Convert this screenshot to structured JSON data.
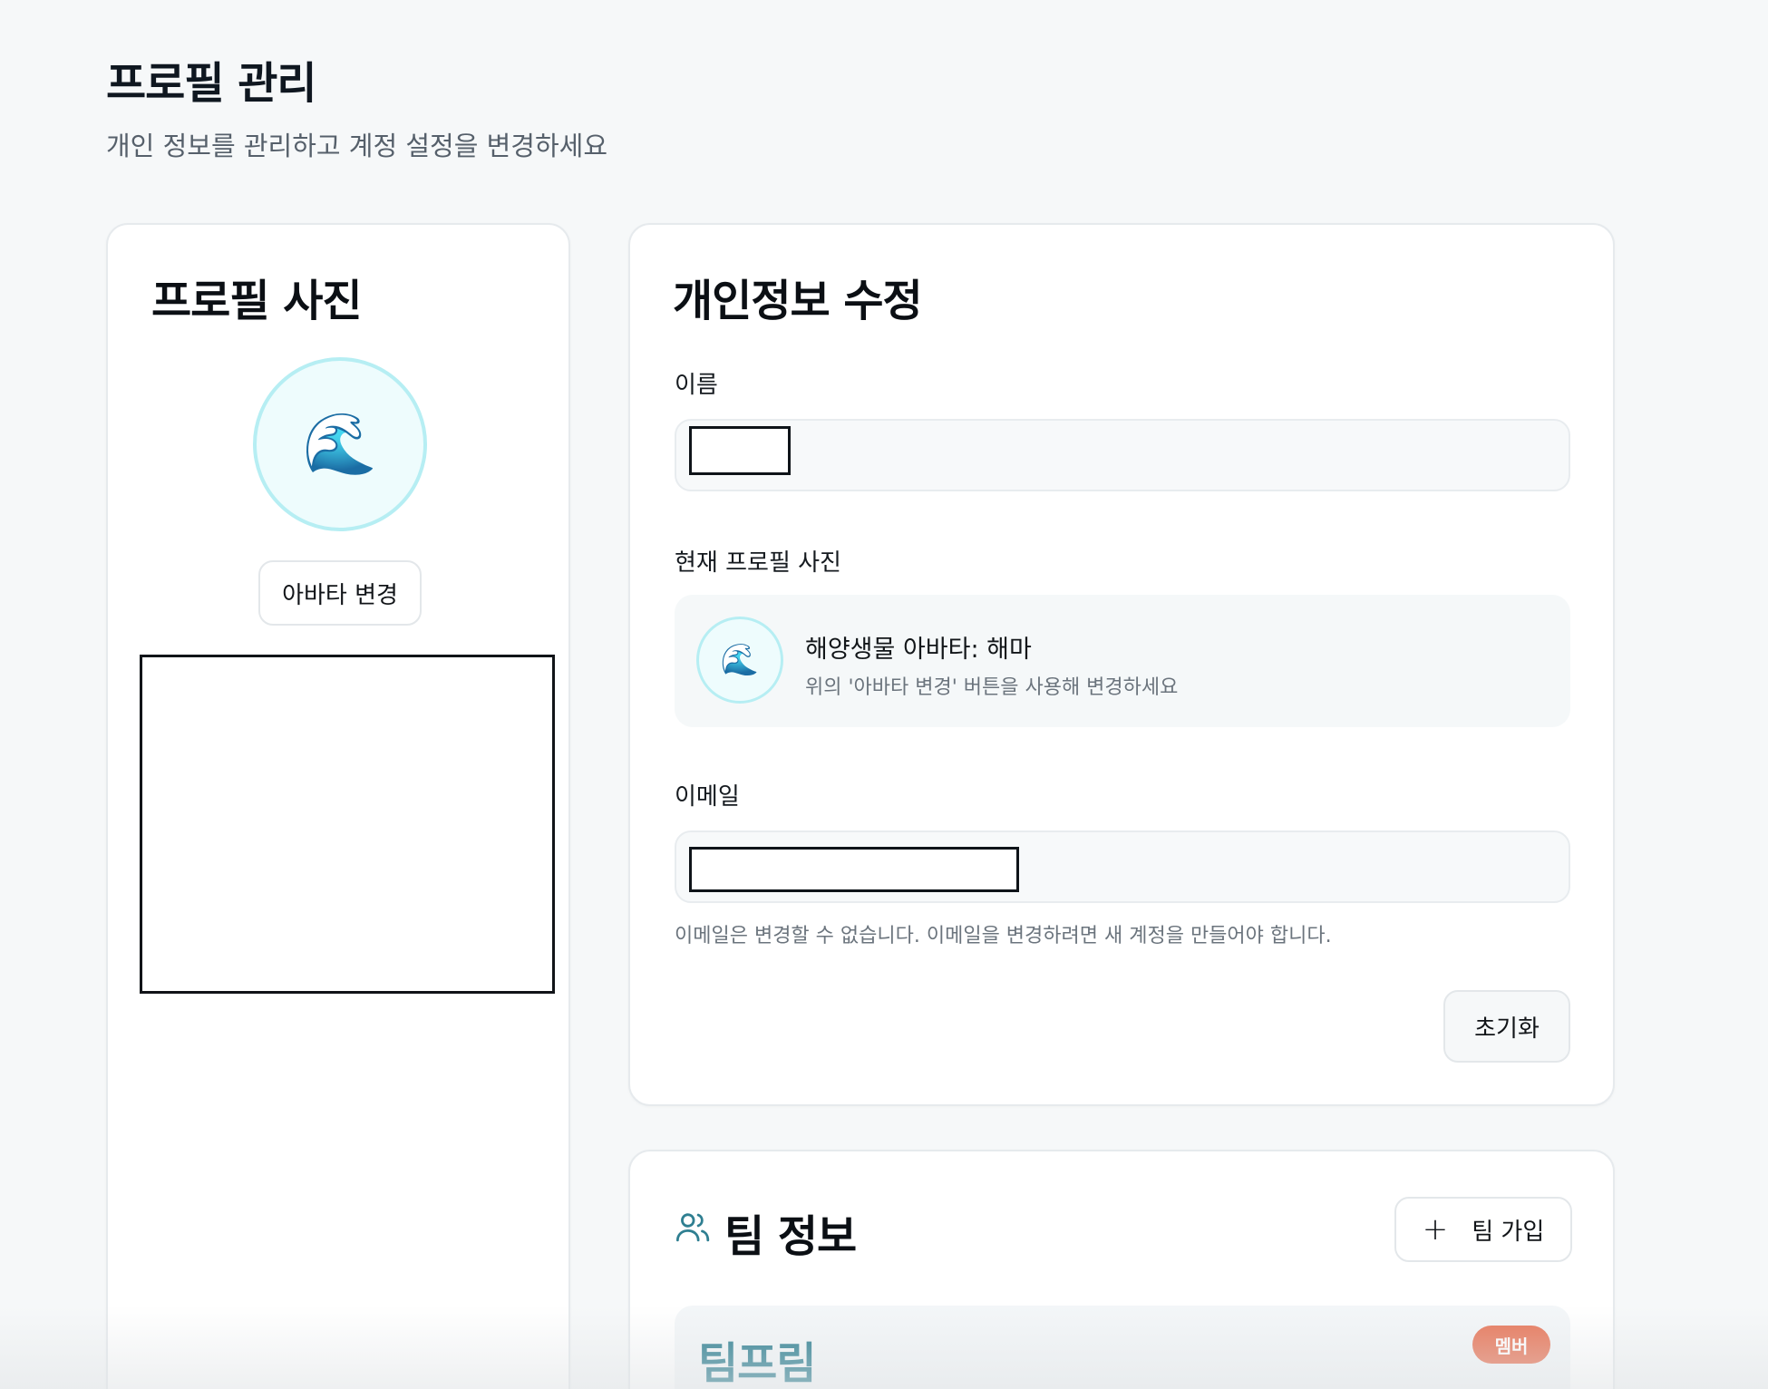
{
  "header": {
    "title": "프로필 관리",
    "subtitle": "개인 정보를 관리하고 계정 설정을 변경하세요"
  },
  "profile_photo_card": {
    "title": "프로필 사진",
    "avatar_emoji": "🌊",
    "change_avatar_label": "아바타 변경"
  },
  "personal_info": {
    "title": "개인정보 수정",
    "name_label": "이름",
    "current_photo_label": "현재 프로필 사진",
    "current_photo_emoji": "🌊",
    "current_photo_title": "해양생물 아바타: 해마",
    "current_photo_hint": "위의 '아바타 변경' 버튼을 사용해 변경하세요",
    "email_label": "이메일",
    "email_help": "이메일은 변경할 수 없습니다. 이메일을 변경하려면 새 계정을 만들어야 합니다.",
    "reset_label": "초기화"
  },
  "team_info": {
    "title": "팀 정보",
    "join_label": "팀 가입",
    "teams": [
      {
        "name": "팀프림",
        "role": "멤버"
      }
    ]
  },
  "colors": {
    "accent_teal": "#2f7f91",
    "badge_orange": "#e7775a",
    "avatar_ring": "#b6eef3"
  }
}
